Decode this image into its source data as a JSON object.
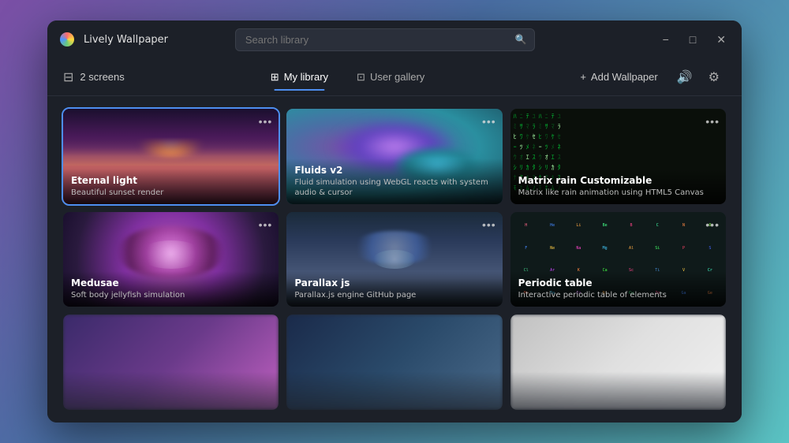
{
  "app": {
    "title": "Lively Wallpaper",
    "logo_alt": "Lively logo"
  },
  "titlebar": {
    "minimize_label": "−",
    "maximize_label": "□",
    "close_label": "✕"
  },
  "search": {
    "placeholder": "Search library",
    "value": ""
  },
  "toolbar": {
    "screens_icon": "⊞",
    "screens_label": "2 screens",
    "library_icon": "⊞",
    "library_label": "My library",
    "gallery_icon": "⊡",
    "gallery_label": "User gallery",
    "add_icon": "+",
    "add_label": "Add Wallpaper",
    "volume_icon": "🔊",
    "settings_icon": "⚙"
  },
  "cards": [
    {
      "id": "eternal-light",
      "title": "Eternal light",
      "description": "Beautiful sunset render",
      "selected": true,
      "style": "eternal"
    },
    {
      "id": "fluids-v2",
      "title": "Fluids v2",
      "description": "Fluid simulation using WebGL reacts with system audio & cursor",
      "selected": false,
      "style": "fluids"
    },
    {
      "id": "matrix-rain",
      "title": "Matrix rain Customizable",
      "description": "Matrix like rain animation using HTML5 Canvas",
      "selected": false,
      "style": "matrix"
    },
    {
      "id": "medusa",
      "title": "Medusae",
      "description": "Soft body jellyfish simulation",
      "selected": false,
      "style": "medusa"
    },
    {
      "id": "parallax-js",
      "title": "Parallax js",
      "description": "Parallax.js engine GitHub page",
      "selected": false,
      "style": "parallax"
    },
    {
      "id": "periodic-table",
      "title": "Periodic table",
      "description": "Interactive periodic table of elements",
      "selected": false,
      "style": "periodic"
    },
    {
      "id": "row3-1",
      "title": "",
      "description": "",
      "selected": false,
      "style": "row3-1"
    },
    {
      "id": "row3-2",
      "title": "",
      "description": "",
      "selected": false,
      "style": "row3-2"
    },
    {
      "id": "row3-3",
      "title": "",
      "description": "",
      "selected": false,
      "style": "row3-3"
    }
  ]
}
